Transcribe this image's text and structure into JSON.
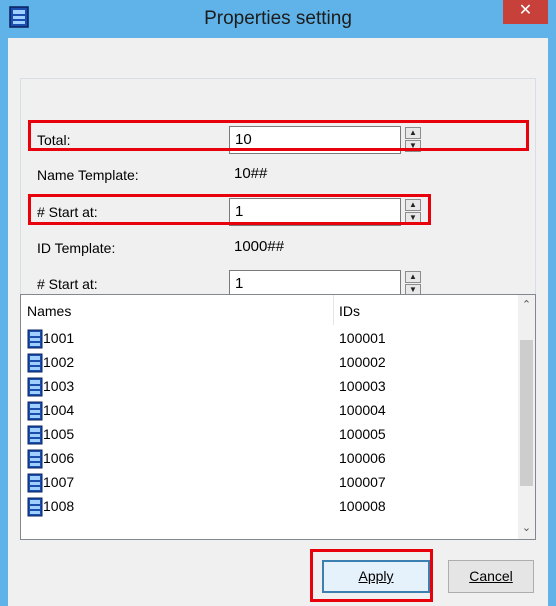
{
  "window": {
    "title": "Properties setting",
    "close_glyph": "✕",
    "accent_color": "#5fb3e8",
    "highlight_color": "#e8000a"
  },
  "form": {
    "total": {
      "label": "Total:",
      "value": "10"
    },
    "name_template": {
      "label": "Name Template:",
      "value": "10##"
    },
    "name_start": {
      "label": "# Start at:",
      "value": "1"
    },
    "id_template": {
      "label": "ID Template:",
      "value": "1000##"
    },
    "id_start": {
      "label": "# Start at:",
      "value": "1"
    }
  },
  "list": {
    "headers": {
      "names": "Names",
      "ids": "IDs"
    },
    "rows": [
      {
        "name": "1001",
        "id": "100001"
      },
      {
        "name": "1002",
        "id": "100002"
      },
      {
        "name": "1003",
        "id": "100003"
      },
      {
        "name": "1004",
        "id": "100004"
      },
      {
        "name": "1005",
        "id": "100005"
      },
      {
        "name": "1006",
        "id": "100006"
      },
      {
        "name": "1007",
        "id": "100007"
      },
      {
        "name": "1008",
        "id": "100008"
      }
    ],
    "item_icon": "list-item-icon"
  },
  "buttons": {
    "apply": "Apply",
    "cancel": "Cancel"
  }
}
